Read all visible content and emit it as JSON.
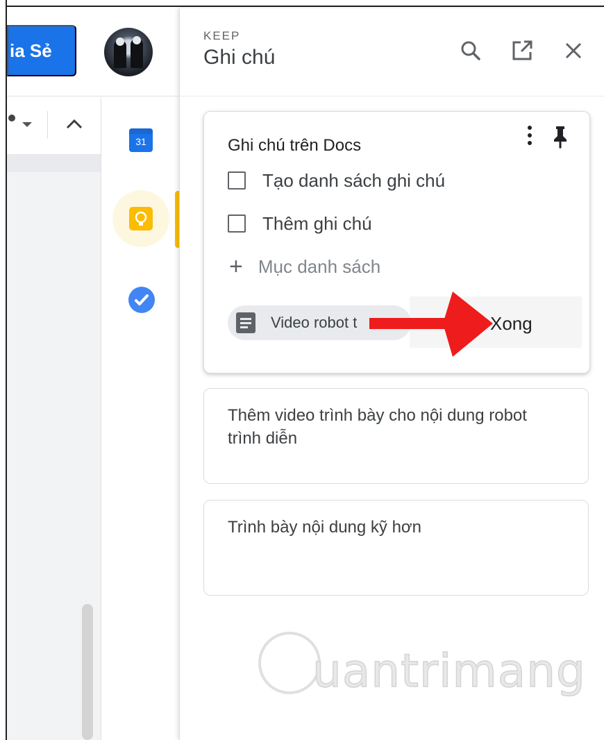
{
  "docs": {
    "share_label": "ia Sẻ",
    "calendar_day": "31"
  },
  "panel": {
    "app_label": "KEEP",
    "title": "Ghi chú"
  },
  "active_note": {
    "title": "Ghi chú trên Docs",
    "items": [
      {
        "text": "Tạo danh sách ghi chú",
        "checked": false
      },
      {
        "text": "Thêm ghi chú",
        "checked": false
      }
    ],
    "add_placeholder": "Mục danh sách",
    "linked_doc": "Video robot t",
    "done_label": "Xong"
  },
  "notes": [
    {
      "text": "Thêm video trình bày cho nội dung robot trình diễn"
    },
    {
      "text": "Trình bày nội dung kỹ hơn"
    }
  ],
  "watermark": "uantrimang",
  "colors": {
    "accent": "#1a73e8",
    "keep_yellow": "#fbbc04",
    "arrow_red": "#ee1c1c"
  },
  "icons": [
    "search-icon",
    "open-in-new-icon",
    "close-icon",
    "more-vert-icon",
    "pin-icon",
    "calendar-icon",
    "keep-icon",
    "tasks-icon",
    "doc-icon",
    "plus-icon"
  ]
}
